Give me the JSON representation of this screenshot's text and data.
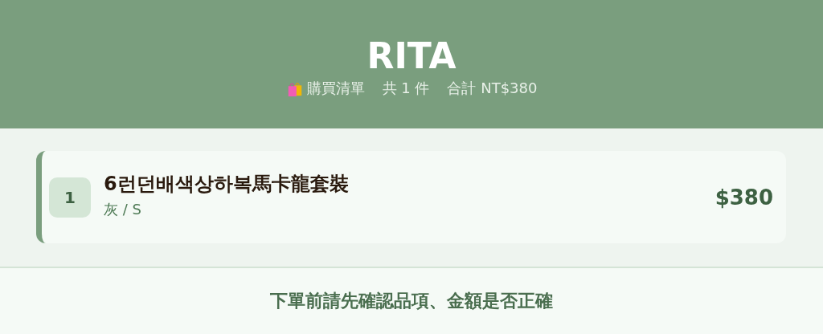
{
  "header": {
    "title": "RITA",
    "list_label": "購買清單",
    "count": "共 1 件",
    "total": "合計 NT$380"
  },
  "items": [
    {
      "index": "1",
      "name": "6런던배색상하복馬卡龍套裝",
      "variant": "灰 / S",
      "price": "$380"
    }
  ],
  "footer": {
    "notice": "下單前請先確認品項、金額是否正確"
  }
}
